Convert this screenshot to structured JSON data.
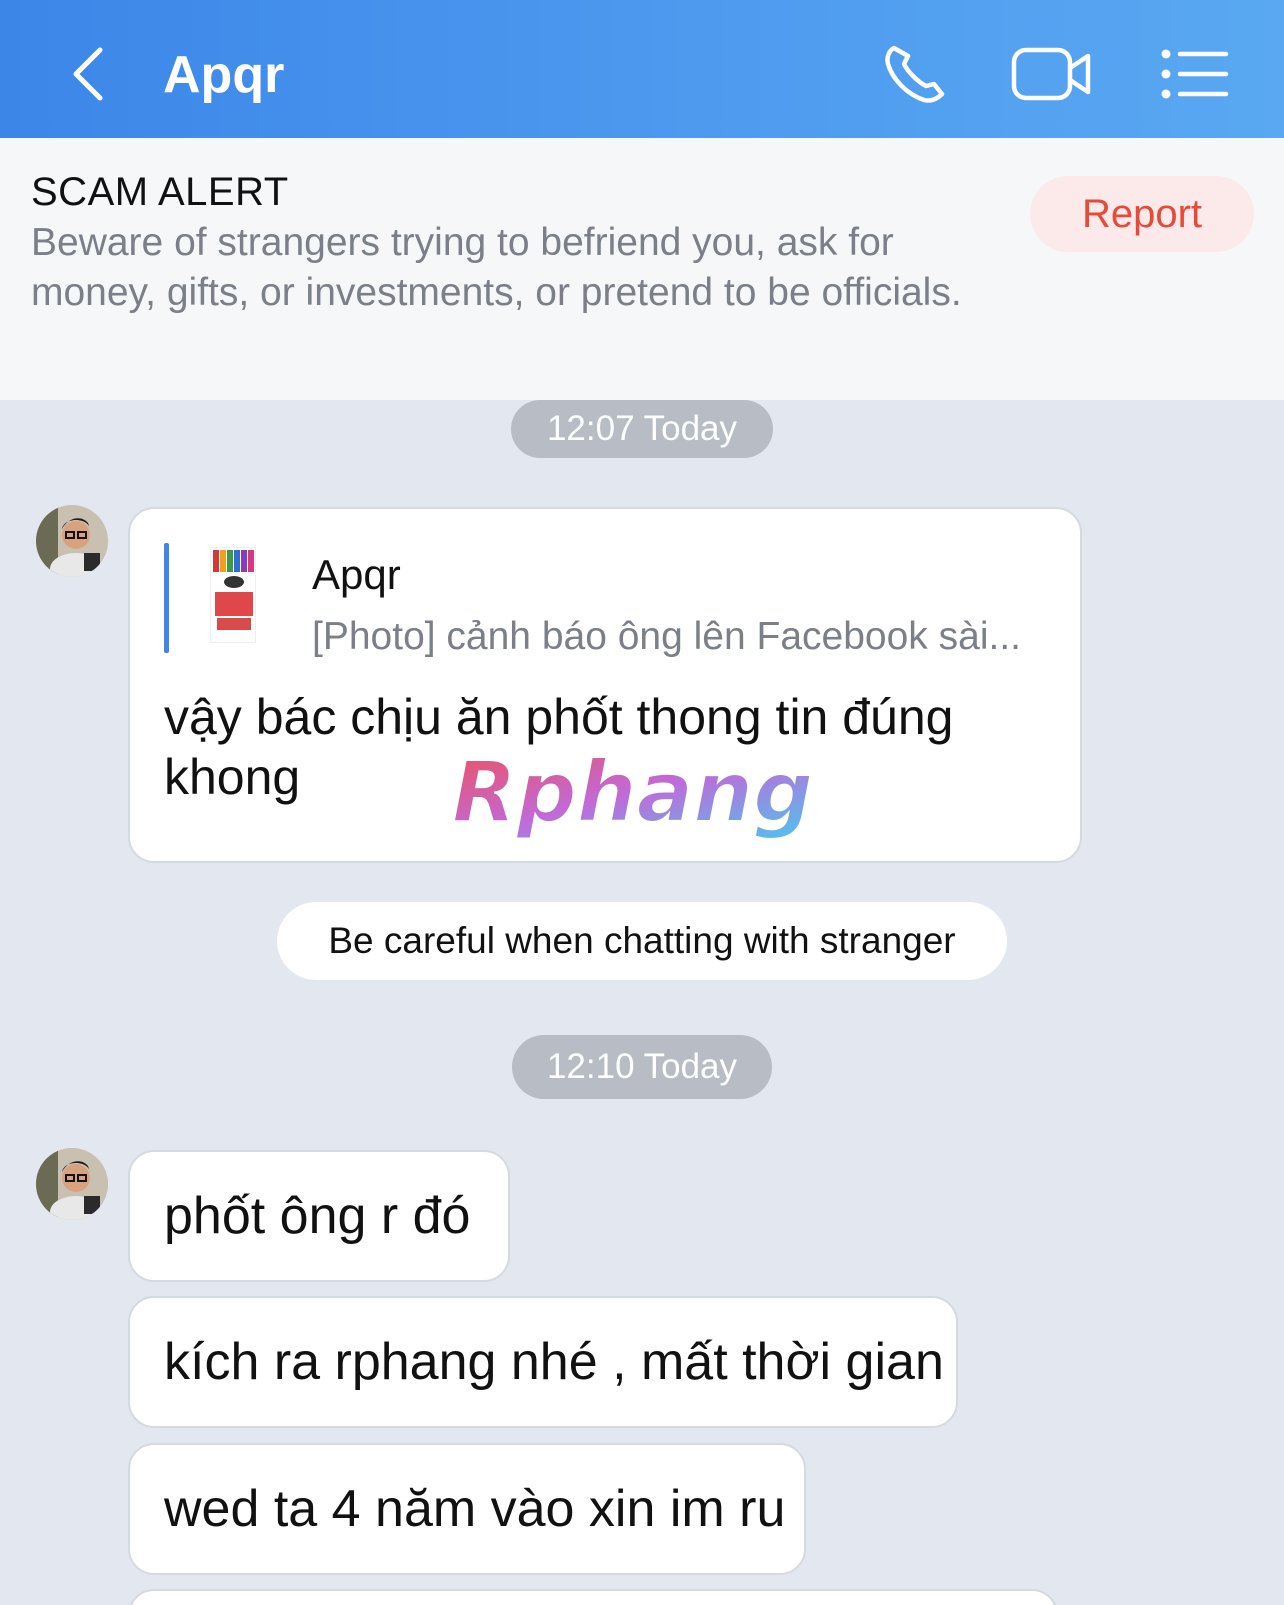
{
  "header": {
    "title": "Apqr",
    "back_icon": "chevron-left-icon",
    "call_icon": "phone-icon",
    "video_icon": "video-camera-icon",
    "menu_icon": "list-menu-icon",
    "bg_color": "#4a95ee"
  },
  "alert": {
    "title": "SCAM ALERT",
    "body": "Beware of strangers trying to befriend you, ask for money, gifts, or investments, or pretend to be officials.",
    "report_label": "Report",
    "report_color": "#e64a3a"
  },
  "chat": {
    "time_1": "12:07 Today",
    "quote": {
      "name": "Apqr",
      "snippet": "[Photo] cảnh báo ông lên Facebook sài...",
      "message": "vậy bác chịu ăn phốt thong tin đúng khong"
    },
    "watermark": "Rphang",
    "notice": "Be careful when chatting with stranger",
    "time_2": "12:10 Today",
    "messages": [
      "phốt ông r đó",
      "kích ra rphang nhé , mất thời gian",
      "wed ta 4 năm vào xin im ru"
    ]
  }
}
